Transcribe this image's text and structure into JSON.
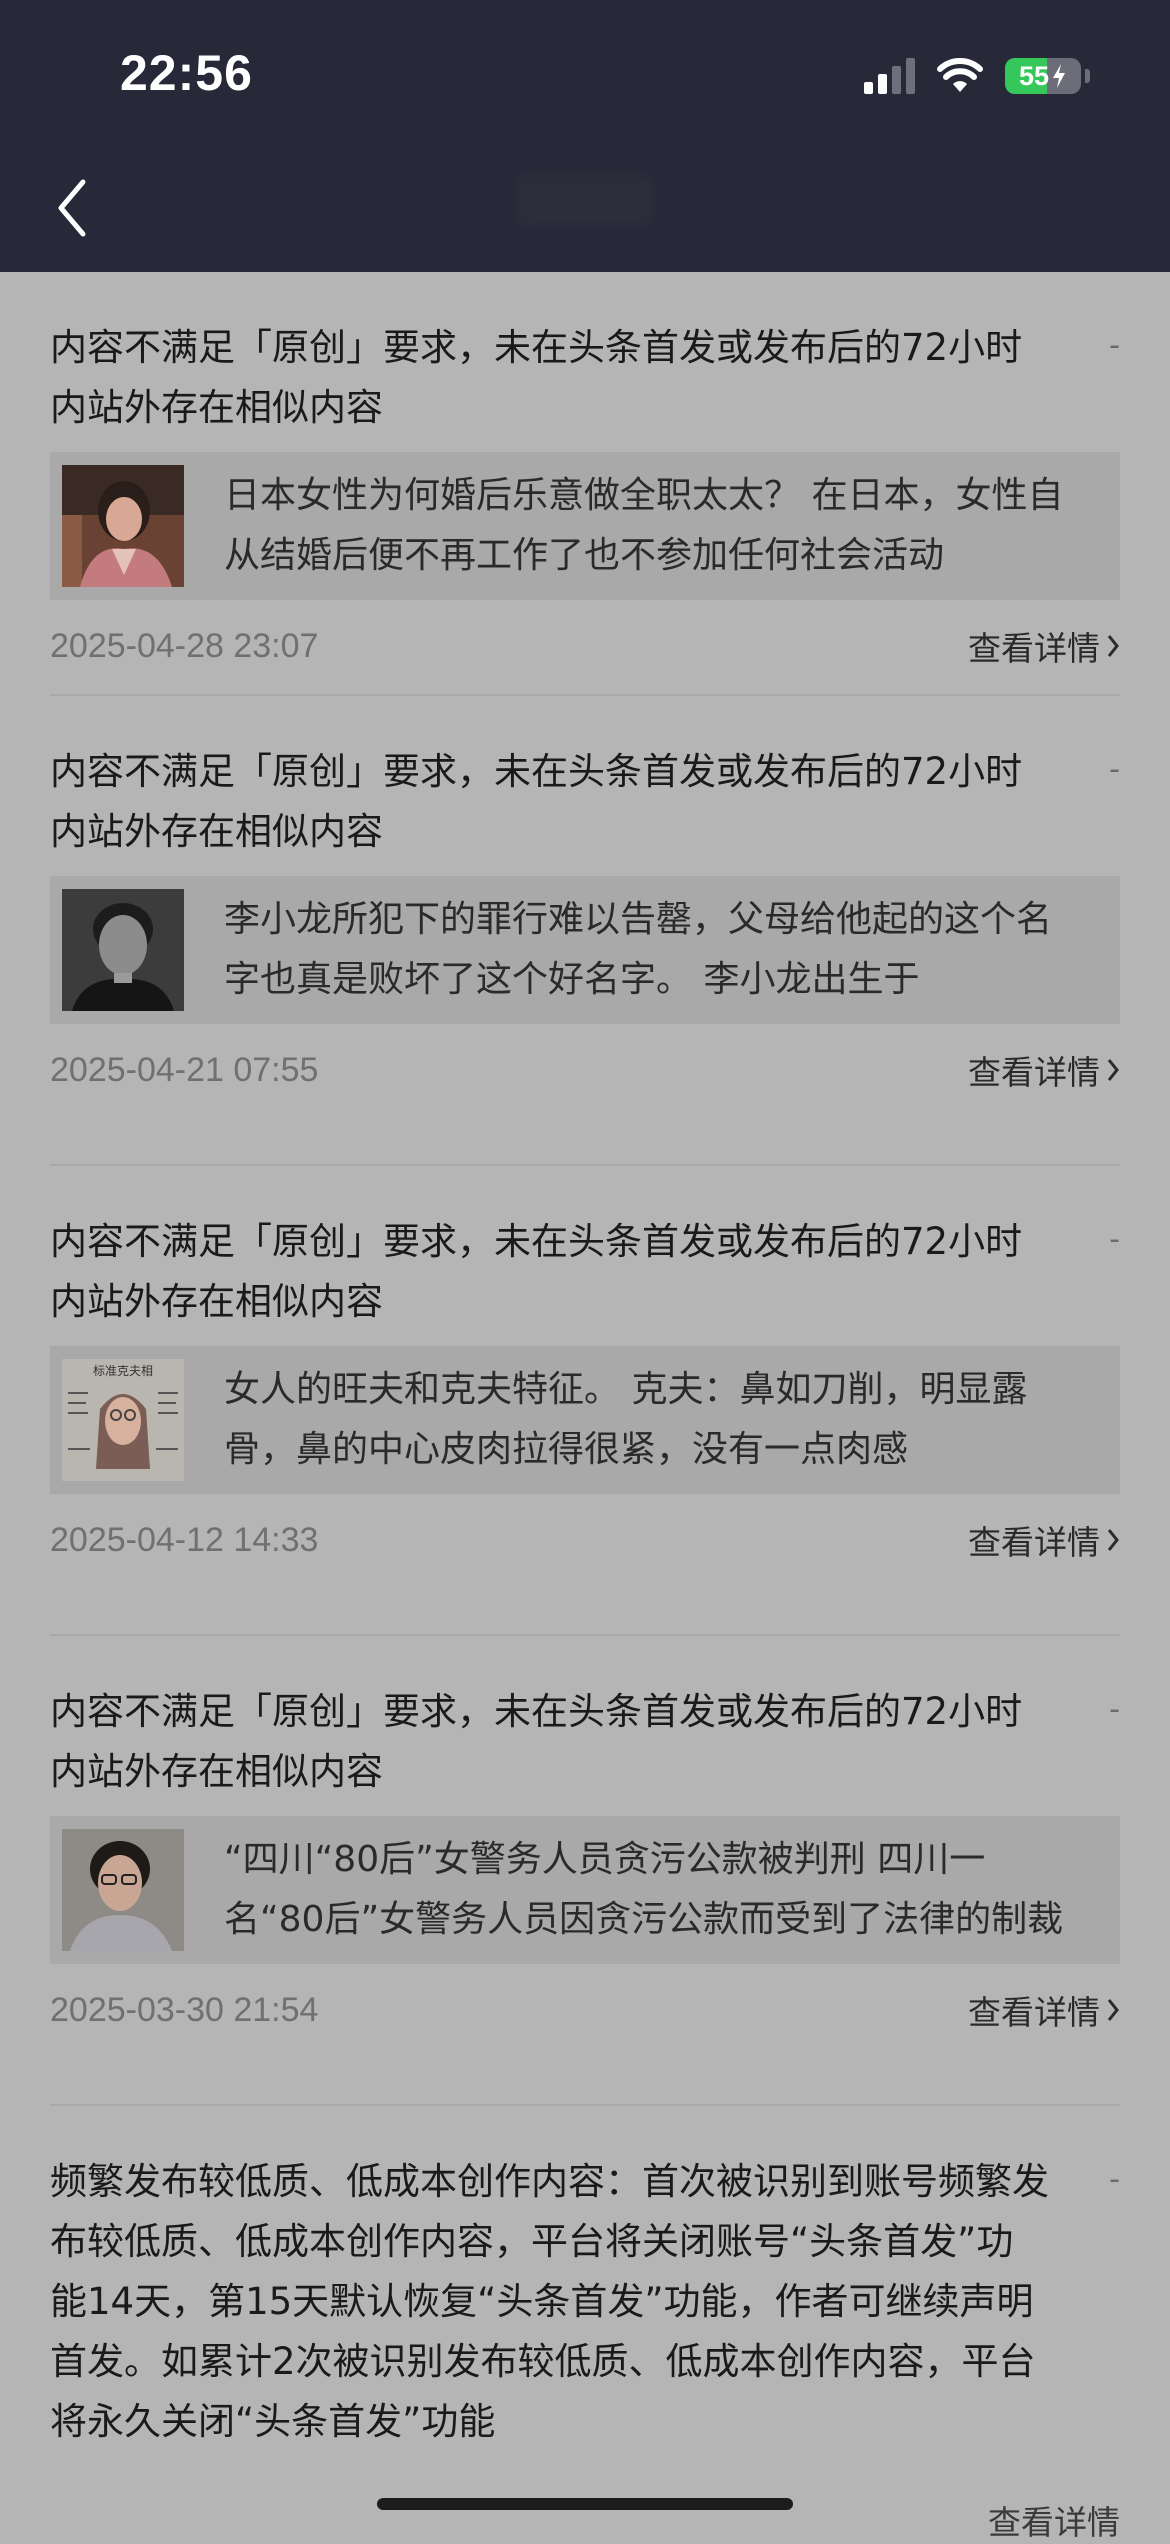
{
  "status_bar": {
    "time": "22:56",
    "battery_level": "55",
    "battery_fraction": 0.55,
    "signal_bars_active": 2,
    "signal_bars_total": 4,
    "icons": [
      "signal-icon",
      "wifi-icon",
      "battery-charging-icon"
    ]
  },
  "nav": {
    "back_icon": "chevron-left-icon",
    "title": "████"
  },
  "items": [
    {
      "title": "内容不满足「原创」要求，未在头条首发或发布后的72小时内站外存在相似内容",
      "dash": "-",
      "thumb_icon": "woman-in-kimono-thumbnail",
      "preview": "日本女性为何婚后乐意做全职太太？ 在日本，女性自从结婚后便不再工作了也不参加任何社会活动",
      "date": "2025-04-28 23:07",
      "detail_label": "查看详情"
    },
    {
      "title": "内容不满足「原创」要求，未在头条首发或发布后的72小时内站外存在相似内容",
      "dash": "-",
      "thumb_icon": "man-portrait-thumbnail",
      "preview": "李小龙所犯下的罪行难以告罄，父母给他起的这个名字也真是败坏了这个好名字。 李小龙出生于",
      "date": "2025-04-21 07:55",
      "detail_label": "查看详情"
    },
    {
      "title": "内容不满足「原创」要求，未在头条首发或发布后的72小时内站外存在相似内容",
      "dash": "-",
      "thumb_icon": "face-diagram-thumbnail",
      "thumb_text": "标准克夫相",
      "preview": "女人的旺夫和克夫特征。 克夫：鼻如刀削，明显露骨，鼻的中心皮肉拉得很紧，没有一点肉感",
      "date": "2025-04-12 14:33",
      "detail_label": "查看详情"
    },
    {
      "title": "内容不满足「原创」要求，未在头条首发或发布后的72小时内站外存在相似内容",
      "dash": "-",
      "thumb_icon": "woman-with-glasses-thumbnail",
      "preview": "“四川“80后”女警务人员贪污公款被判刑 四川一名“80后”女警务人员因贪污公款而受到了法律的制裁",
      "date": "2025-03-30 21:54",
      "detail_label": "查看详情"
    }
  ],
  "last_item": {
    "title": "频繁发布较低质、低成本创作内容：首次被识别到账号频繁发布较低质、低成本创作内容，平台将关闭账号“头条首发”功能14天，第15天默认恢复“头条首发”功能，作者可继续声明首发。如累计2次被识别发布较低质、低成本创作内容，平台将永久关闭“头条首发”功能",
    "dash": "-",
    "detail_label": "查看详情"
  }
}
